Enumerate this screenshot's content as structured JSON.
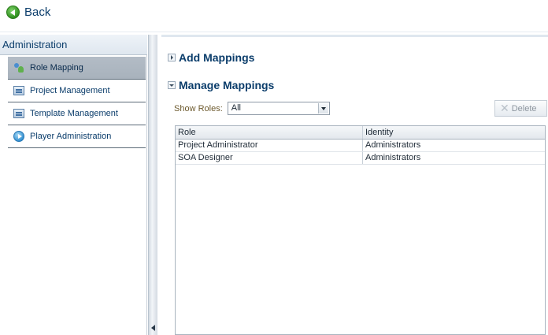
{
  "topbar": {
    "back_label": "Back"
  },
  "sidebar": {
    "header": "Administration",
    "items": [
      {
        "label": "Role Mapping",
        "icon": "role-mapping-icon",
        "selected": true
      },
      {
        "label": "Project Management",
        "icon": "project-icon",
        "selected": false
      },
      {
        "label": "Template Management",
        "icon": "template-icon",
        "selected": false
      },
      {
        "label": "Player Administration",
        "icon": "player-icon",
        "selected": false
      }
    ]
  },
  "main": {
    "add_section": {
      "title": "Add Mappings",
      "expanded": false
    },
    "manage_section": {
      "title": "Manage Mappings",
      "expanded": true
    },
    "filter": {
      "label": "Show Roles:",
      "selected": "All"
    },
    "delete_label": "Delete",
    "table": {
      "columns": [
        "Role",
        "Identity"
      ],
      "rows": [
        [
          "Project Administrator",
          "Administrators"
        ],
        [
          "SOA Designer",
          "Administrators"
        ]
      ]
    }
  }
}
